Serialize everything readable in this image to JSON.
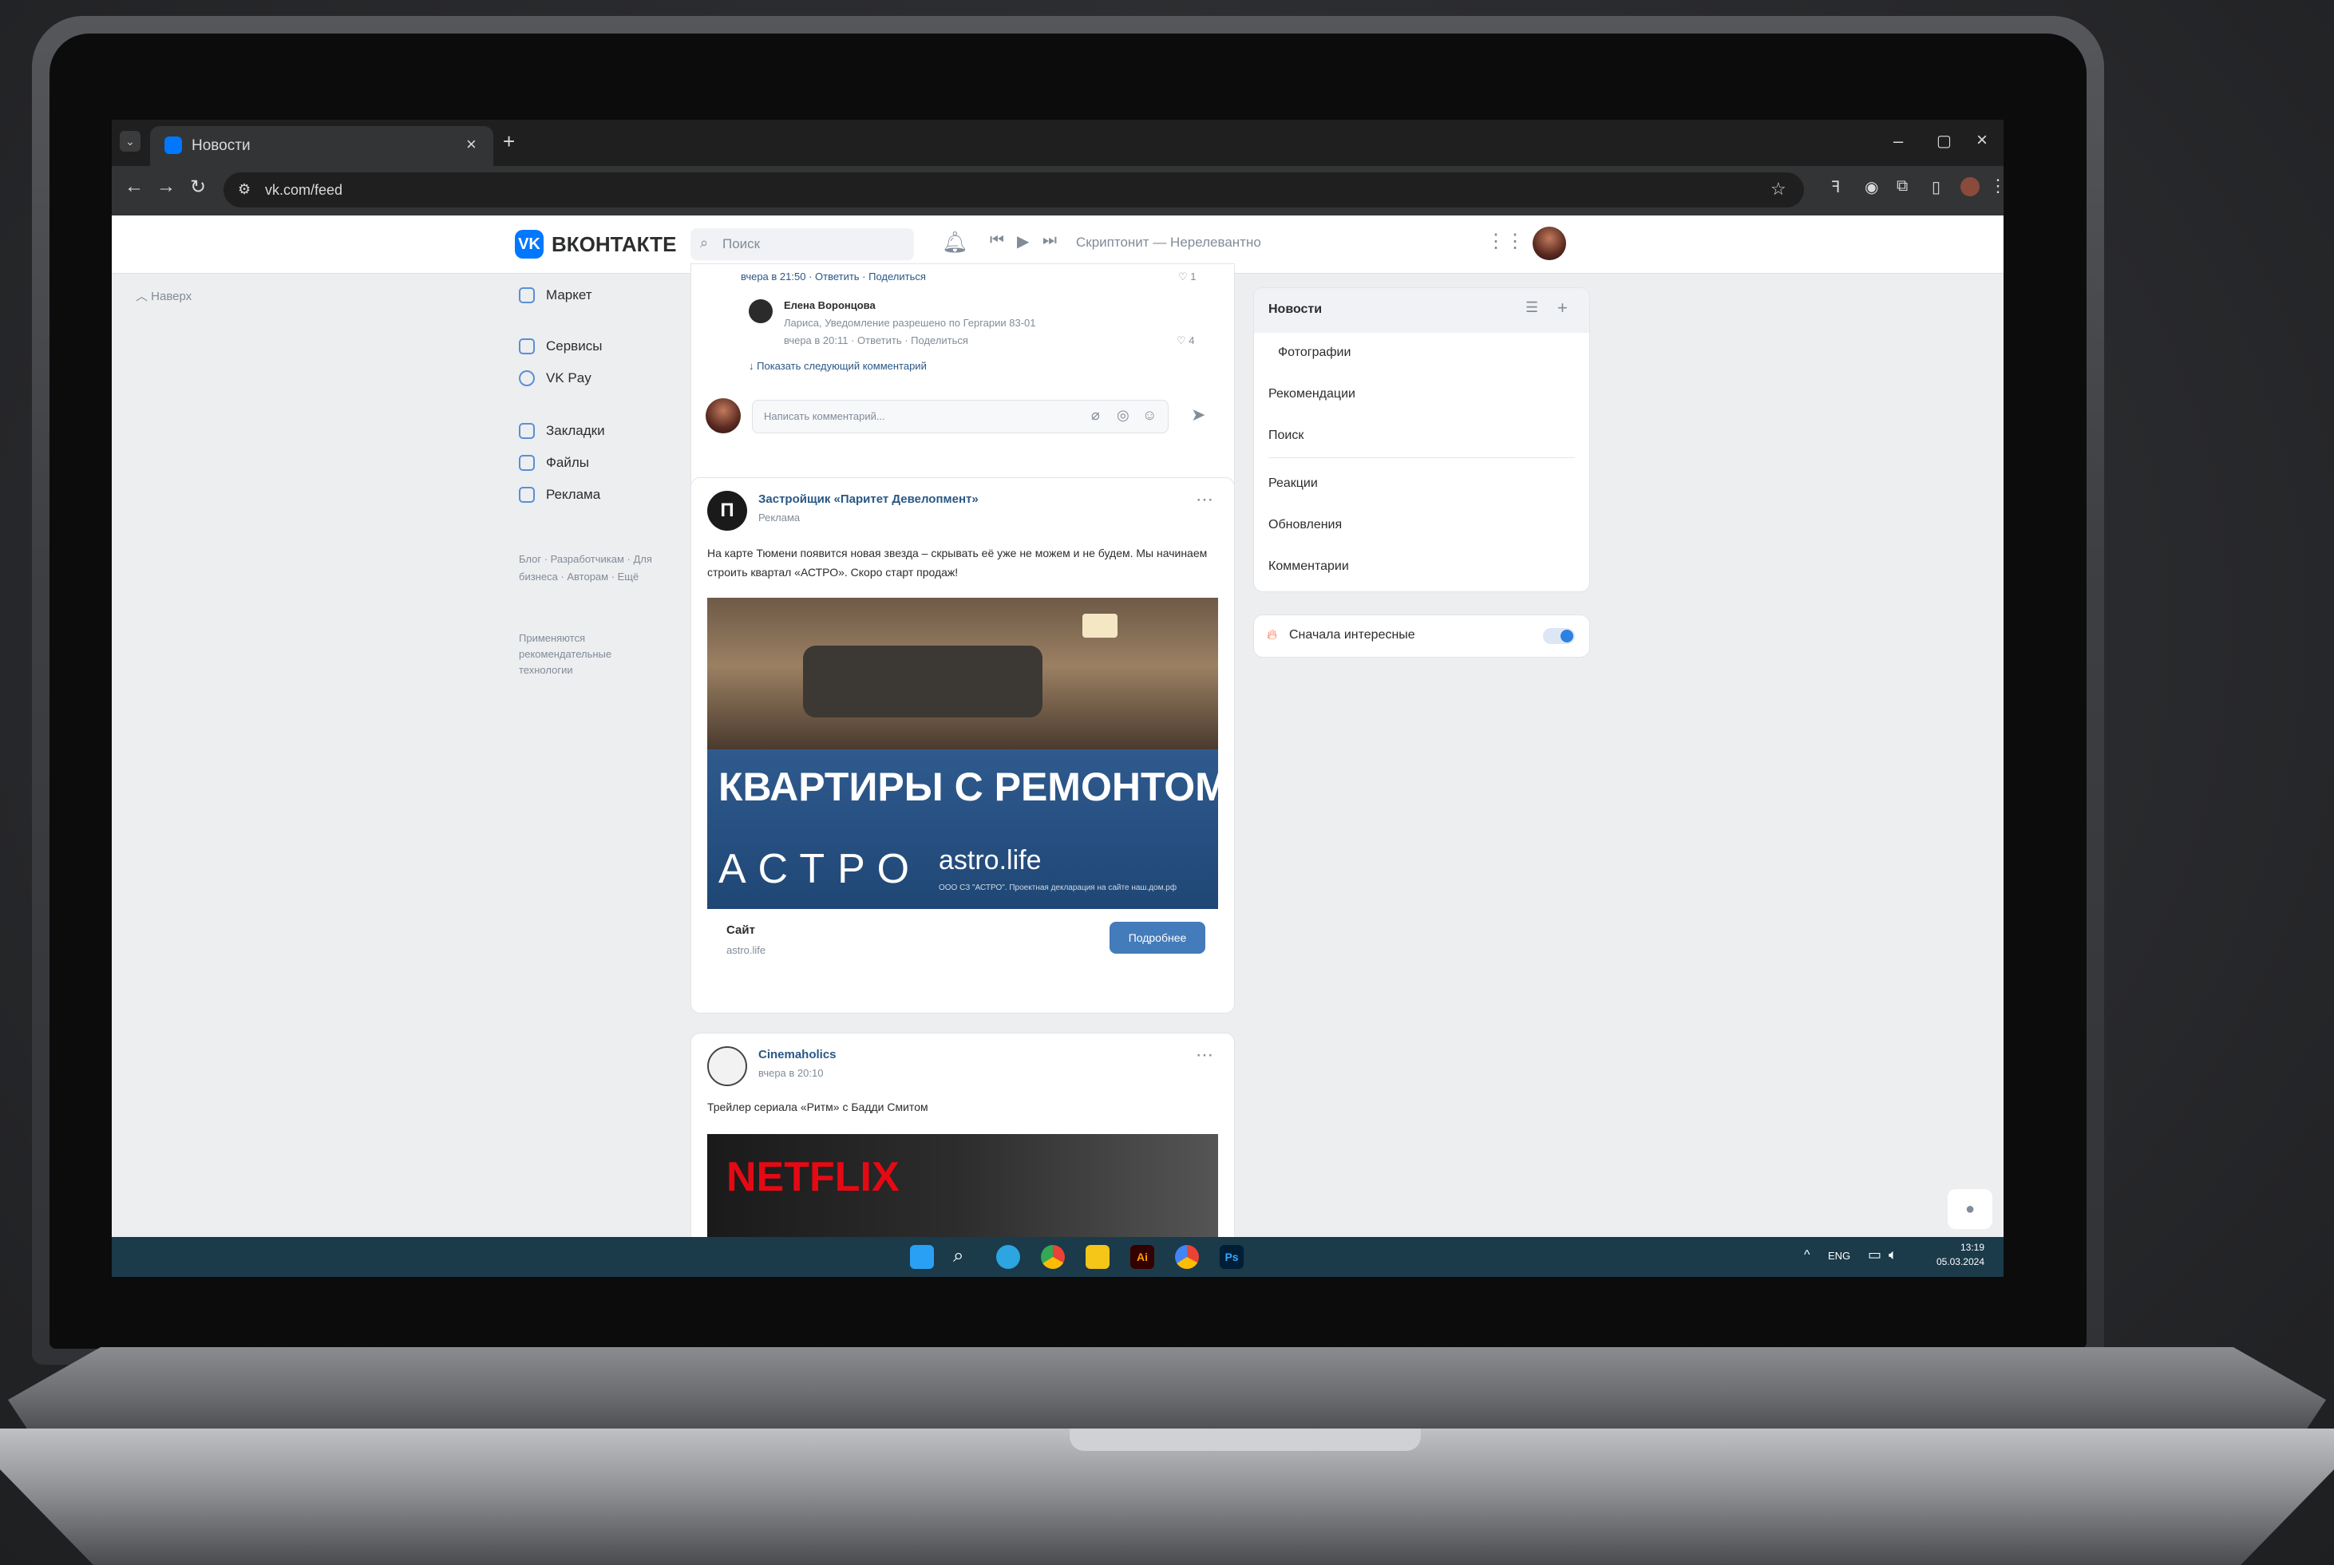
{
  "browser": {
    "tab_title": "Новости",
    "url": "vk.com/feed"
  },
  "vk": {
    "logo_text": "ВКОНТАКТЕ",
    "search_placeholder": "Поиск",
    "player_text": "Скриптонит — Нерелевантно",
    "brand_color": "#0077ff"
  },
  "sidebar": {
    "top_label": "Наверх",
    "items": [
      {
        "label": "Маркет",
        "icon": "bag-icon"
      },
      {
        "label": "Сервисы",
        "icon": "grid-icon"
      },
      {
        "label": "VK Pay",
        "icon": "vkpay-icon"
      },
      {
        "label": "Закладки",
        "icon": "bookmark-icon"
      },
      {
        "label": "Файлы",
        "icon": "file-icon"
      },
      {
        "label": "Реклама",
        "icon": "megaphone-icon"
      }
    ],
    "footer_links": "Блог · Разработчикам · Для бизнеса · Авторам · Ещё",
    "footer_note": "Применяются рекомендательные технологии"
  },
  "feed": {
    "prev_post": {
      "comment_meta": "вчера в 21:50 · Ответить · Поделиться",
      "comment_likes": "1",
      "reply_author": "Елена Воронцова",
      "reply_text": "Лариса, Уведомление разрешено по Гергарии 83-01",
      "reply_meta": "вчера в 20:11 · Ответить · Поделиться",
      "reply_likes": "4",
      "show_more": "Показать следующий комментарий",
      "comment_placeholder": "Написать комментарий..."
    },
    "ad_post": {
      "author": "Застройщик «Паритет Девелопмент»",
      "subtitle": "Реклама",
      "text": "На карте Тюмени появится новая звезда – скрывать её уже не можем и не будем. Мы начинаем строить квартал «АСТРО». Скоро старт продаж!",
      "image_headline": "КВАРТИРЫ С РЕМОНТОМ",
      "image_brand": "АСТРО",
      "image_site": "astro.life",
      "image_fineprint": "ООО СЗ \"АСТРО\". Проектная декларация на сайте наш.дом.рф",
      "link_title": "Сайт",
      "link_domain": "astro.life",
      "cta": "Подробнее"
    },
    "next_post": {
      "author": "Cinemaholics",
      "time": "вчера в 20:10",
      "text": "Трейлер сериала «Ритм» с Бадди Смитом",
      "image_text": "NETFLIX"
    }
  },
  "filters": {
    "header": "Новости",
    "items": [
      "Фотографии",
      "Рекомендации",
      "Поиск",
      "Реакции",
      "Обновления",
      "Комментарии"
    ],
    "toggle_label": "Сначала интересные"
  },
  "taskbar": {
    "lang": "ENG",
    "time": "13:19",
    "date": "05.03.2024"
  }
}
